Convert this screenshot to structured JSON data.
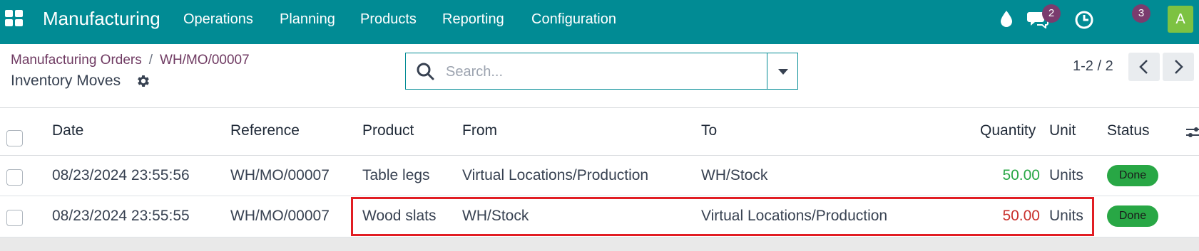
{
  "navbar": {
    "app_name": "Manufacturing",
    "menu": [
      "Operations",
      "Planning",
      "Products",
      "Reporting",
      "Configuration"
    ],
    "messages_count": "2",
    "activities_count": "3",
    "avatar_letter": "A",
    "bg_color": "#018b94"
  },
  "control": {
    "breadcrumb": [
      "Manufacturing Orders",
      "WH/MO/00007"
    ],
    "breadcrumb_separator": "/",
    "title": "Inventory Moves",
    "search_placeholder": "Search...",
    "pager": "1-2 / 2"
  },
  "table": {
    "columns": [
      "Date",
      "Reference",
      "Product",
      "From",
      "To",
      "Quantity",
      "Unit",
      "Status"
    ],
    "rows": [
      {
        "date": "08/23/2024 23:55:56",
        "reference": "WH/MO/00007",
        "product": "Table legs",
        "from": "Virtual Locations/Production",
        "to": "WH/Stock",
        "quantity": "50.00",
        "unit": "Units",
        "status": "Done"
      },
      {
        "date": "08/23/2024 23:55:55",
        "reference": "WH/MO/00007",
        "product": "Wood slats",
        "from": "WH/Stock",
        "to": "Virtual Locations/Production",
        "quantity": "50.00",
        "unit": "Units",
        "status": "Done"
      }
    ]
  },
  "colors": {
    "positive_qty": "#28a745",
    "negative_qty": "#c9302c",
    "status_done": "#28a745",
    "highlight": "#e11d23"
  }
}
